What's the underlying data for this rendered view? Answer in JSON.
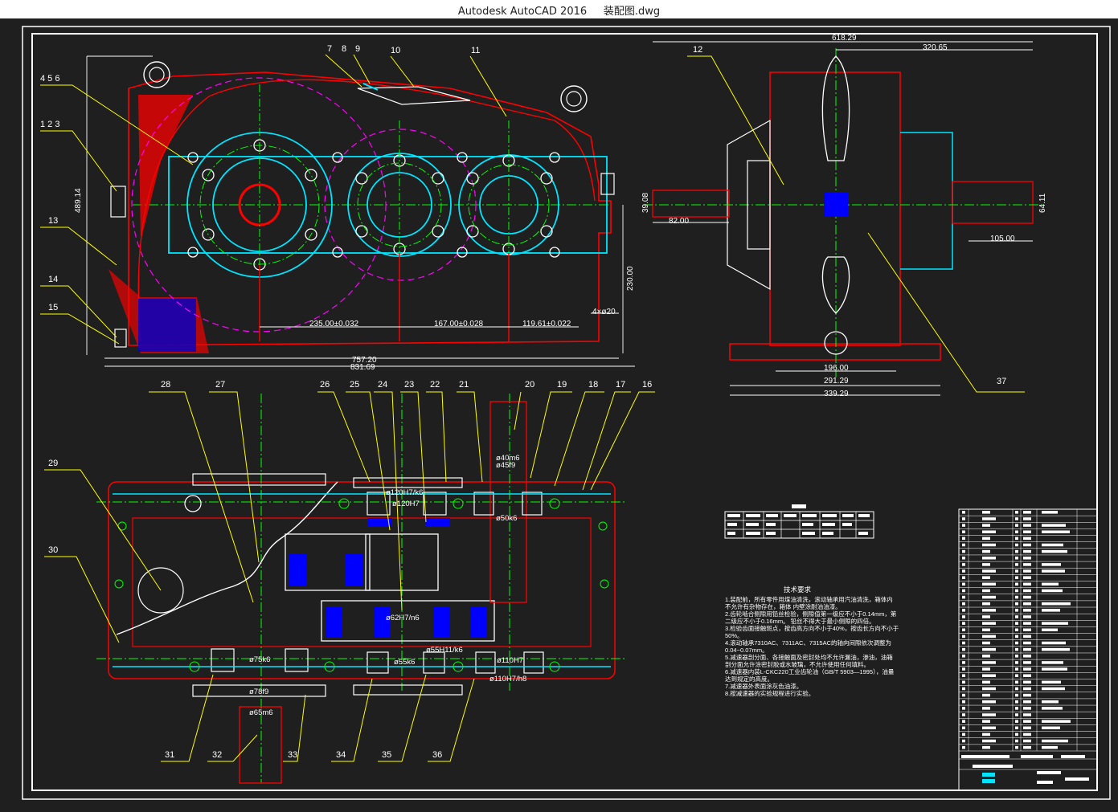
{
  "window": {
    "app": "Autodesk AutoCAD 2016",
    "file": "装配图.dwg"
  },
  "colors": {
    "background": "#1f1f1f",
    "frame": "#ffffff",
    "housing": "#ff0000",
    "flange": "#00e5ff",
    "centerline": "#00ff00",
    "gear_circle": "#ff00ff",
    "leader": "#ffff00",
    "dimension": "#ffff00",
    "hatch": "#0000ff",
    "text": "#ffffff"
  },
  "top_view": {
    "part_numbers": [
      "7",
      "8",
      "9",
      "10",
      "11",
      "4 5 6",
      "1 2 3",
      "13",
      "14",
      "15"
    ],
    "dimensions": {
      "height": "489.14",
      "h2": "230.00",
      "a1": "235.00±0.032",
      "a2": "167.00±0.028",
      "a3": "119.61±0.022",
      "holes": "4×ø20",
      "w1": "757.20",
      "w2": "831.69"
    }
  },
  "side_view": {
    "part_numbers": [
      "12",
      "37"
    ],
    "dimensions": {
      "overall": "618.29",
      "half": "320.65",
      "shaft_dia_left": "39.08",
      "shaft_len_left": "82.00",
      "shaft_dia_right": "64.11",
      "shaft_len_right": "105.00",
      "base1": "196.00",
      "base2": "291.29",
      "base3": "339.29"
    }
  },
  "bottom_view": {
    "part_numbers_top": [
      "28",
      "27",
      "26",
      "25",
      "24",
      "23",
      "22",
      "21",
      "20",
      "19",
      "18",
      "17",
      "16"
    ],
    "part_numbers_left": [
      "29",
      "30"
    ],
    "part_numbers_bottom": [
      "31",
      "32",
      "33",
      "34",
      "35",
      "36"
    ],
    "fits": {
      "f1": "ø120H7/k6",
      "f2": "ø120H7",
      "f3": "ø40m6",
      "f4": "ø45f9",
      "f5": "ø50k6",
      "f6": "ø62H7/n6",
      "f7": "ø55H11/k6",
      "f8": "ø75k6",
      "f9": "ø55k6",
      "f10": "ø110H7",
      "f11": "ø110H7/h8",
      "f12": "ø78f9",
      "f13": "ø65m6"
    }
  },
  "tech_requirements": {
    "title": "技术要求",
    "lines": [
      "1.装配前，所有零件用煤油清洗，滚动轴承用汽油清洗，箱体内",
      "不允许有杂物存在，箱体 内壁涂耐油油漆。",
      "2.齿轮啮合侧隙用铅丝检验，侧隙值第一级应不小于0.14mm，第",
      "二级应不小于0.16mm。 铅丝不得大于最小侧隙的四倍。",
      "3.检验齿面接触斑点，按齿高方向不小于40%，按齿长方向不小于",
      "50%。",
      "4.滚动轴承7310AC、7311AC、7315AC的轴向间隙依次调整为",
      "0.04~0.07mm。",
      "5.减速器剖分面、各接触面及密封处均不允许漏油，渗油，油箱",
      "剖分面允许涂密封胶或水玻璃，不允许使用任何填料。",
      "6.减速器内装L-CKC220工业齿轮油（GB/T 5903—1995），油量",
      "达到规定的高度。",
      "7.减速器外表面涂灰色油漆。",
      "8.按减速器的实验规程进行实验。"
    ]
  }
}
